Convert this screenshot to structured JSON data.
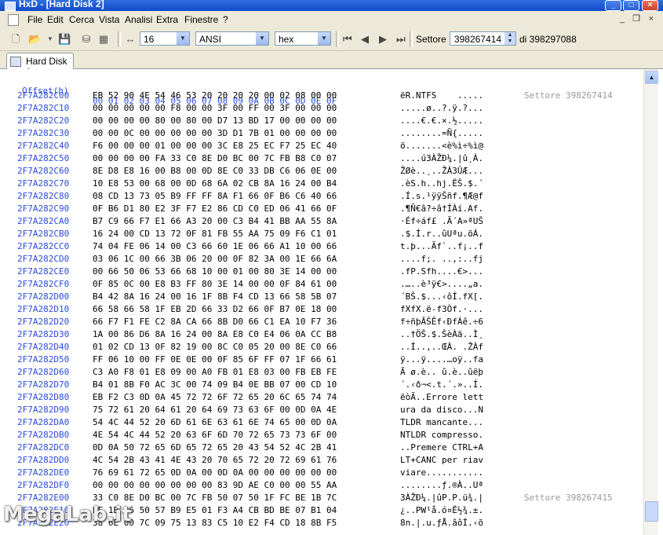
{
  "window": {
    "title": "HxD - [Hard Disk 2]",
    "minimize": "_",
    "maximize": "□",
    "close": "×"
  },
  "menu": {
    "items": [
      "File",
      "Edit",
      "Cerca",
      "Vista",
      "Analisi",
      "Extra",
      "Finestre",
      "?"
    ],
    "mdi_min": "_",
    "mdi_restore": "❐",
    "mdi_close": "×"
  },
  "toolbar": {
    "bytes_per_row": "16",
    "charset": "ANSI",
    "display": "hex",
    "sector_label": "Settore",
    "sector_value": "398267414",
    "sector_total": "di 398297088"
  },
  "tab": {
    "label": "Hard Disk 2"
  },
  "hex": {
    "offset_header": "Offset(h)",
    "column_header": "00 01 02 03 04 05 06 07 08 09 0A 0B 0C 0D 0E 0F",
    "rows": [
      {
        "o": "2F7A282C00",
        "b": "EB 52 90 4E 54 46 53 20 20 20 20 00 02 08 00 00",
        "a": "ëR.NTFS    .....",
        "s": "Settore 398267414"
      },
      {
        "o": "2F7A282C10",
        "b": "00 00 00 00 00 F8 00 00 3F 00 FF 00 3F 00 00 00",
        "a": ".....ø..?.ÿ.?...",
        "s": ""
      },
      {
        "o": "2F7A282C20",
        "b": "00 00 00 00 80 00 80 00 D7 13 BD 17 00 00 00 00",
        "a": "....€.€.×.½.....",
        "s": ""
      },
      {
        "o": "2F7A282C30",
        "b": "00 00 0C 00 00 00 00 00 3D D1 7B 01 00 00 00 00",
        "a": "........=Ñ{.....",
        "s": ""
      },
      {
        "o": "2F7A282C40",
        "b": "F6 00 00 00 01 00 00 00 3C E8 25 EC F7 25 EC 40",
        "a": "ö.......<è%ì÷%ì@",
        "s": ""
      },
      {
        "o": "2F7A282C50",
        "b": "00 00 00 00 FA 33 C0 8E D0 BC 00 7C FB B8 C0 07",
        "a": "....ú3ÀŽĐ¼.|û¸À.",
        "s": ""
      },
      {
        "o": "2F7A282C60",
        "b": "8E D8 E8 16 00 B8 00 0D 8E C0 33 DB C6 06 0E 00",
        "a": "ŽØè..¸..ŽÀ3ÛÆ...",
        "s": ""
      },
      {
        "o": "2F7A282C70",
        "b": "10 E8 53 00 68 00 0D 68 6A 02 CB 8A 16 24 00 B4",
        "a": ".èS.h..hj.ËŠ.$.´",
        "s": ""
      },
      {
        "o": "2F7A282C80",
        "b": "08 CD 13 73 05 B9 FF FF 8A F1 66 0F B6 C6 40 66",
        "a": ".Í.s.¹ÿÿŠñf.¶Æ@f",
        "s": ""
      },
      {
        "o": "2F7A282C90",
        "b": "0F B6 D1 80 E2 3F F7 E2 86 CD C0 ED 06 41 66 0F",
        "a": ".¶Ñ€â?÷â†ÍÀí.Af.",
        "s": ""
      },
      {
        "o": "2F7A282CA0",
        "b": "B7 C9 66 F7 E1 66 A3 20 00 C3 B4 41 BB AA 55 8A",
        "a": "·Éf÷áf£ .Ã´A»ªUŠ",
        "s": ""
      },
      {
        "o": "2F7A282CB0",
        "b": "16 24 00 CD 13 72 0F 81 FB 55 AA 75 09 F6 C1 01",
        "a": ".$.Í.r..ûUªu.öÁ.",
        "s": ""
      },
      {
        "o": "2F7A282CC0",
        "b": "74 04 FE 06 14 00 C3 66 60 1E 06 66 A1 10 00 66",
        "a": "t.þ...Ãf`..f¡..f",
        "s": ""
      },
      {
        "o": "2F7A282CD0",
        "b": "03 06 1C 00 66 3B 06 20 00 0F 82 3A 00 1E 66 6A",
        "a": "....f;. ..‚:..fj",
        "s": ""
      },
      {
        "o": "2F7A282CE0",
        "b": "00 66 50 06 53 66 68 10 00 01 00 80 3E 14 00 00",
        "a": ".fP.Sfh....€>...",
        "s": ""
      },
      {
        "o": "2F7A282CF0",
        "b": "0F 85 0C 00 E8 B3 FF 80 3E 14 00 00 0F 84 61 00",
        "a": ".…..è³ÿ€>....„a.",
        "s": ""
      },
      {
        "o": "2F7A282D00",
        "b": "B4 42 8A 16 24 00 16 1F 8B F4 CD 13 66 58 5B 07",
        "a": "´BŠ.$...‹ôÍ.fX[.",
        "s": ""
      },
      {
        "o": "2F7A282D10",
        "b": "66 58 66 58 1F EB 2D 66 33 D2 66 0F B7 0E 18 00",
        "a": "fXfX.ë-f3Òf.·...",
        "s": ""
      },
      {
        "o": "2F7A282D20",
        "b": "66 F7 F1 FE C2 8A CA 66 8B D0 66 C1 EA 10 F7 36",
        "a": "f÷ñþÂŠÊf‹ĐfÁê.÷6",
        "s": ""
      },
      {
        "o": "2F7A282D30",
        "b": "1A 00 86 D6 8A 16 24 00 8A E8 C0 E4 06 0A CC B8",
        "a": "..†ÖŠ.$.ŠèÀä..Ì¸",
        "s": ""
      },
      {
        "o": "2F7A282D40",
        "b": "01 02 CD 13 0F 82 19 00 8C C0 05 20 00 8E C0 66",
        "a": "..Í..‚..ŒÀ. .ŽÀf",
        "s": ""
      },
      {
        "o": "2F7A282D50",
        "b": "FF 06 10 00 FF 0E 0E 00 0F 85 6F FF 07 1F 66 61",
        "a": "ÿ...ÿ....…oÿ..fa",
        "s": ""
      },
      {
        "o": "2F7A282D60",
        "b": "C3 A0 F8 01 E8 09 00 A0 FB 01 E8 03 00 FB EB FE",
        "a": "Ã ø.è.. û.è..ûëþ",
        "s": ""
      },
      {
        "o": "2F7A282D70",
        "b": "B4 01 8B F0 AC 3C 00 74 09 B4 0E BB 07 00 CD 10",
        "a": "´.‹ð¬<.t.´.»..Í.",
        "s": ""
      },
      {
        "o": "2F7A282D80",
        "b": "EB F2 C3 0D 0A 45 72 72 6F 72 65 20 6C 65 74 74",
        "a": "ëòÃ..Errore lett",
        "s": ""
      },
      {
        "o": "2F7A282D90",
        "b": "75 72 61 20 64 61 20 64 69 73 63 6F 00 0D 0A 4E",
        "a": "ura da disco...N",
        "s": ""
      },
      {
        "o": "2F7A282DA0",
        "b": "54 4C 44 52 20 6D 61 6E 63 61 6E 74 65 00 0D 0A",
        "a": "TLDR mancante...",
        "s": ""
      },
      {
        "o": "2F7A282DB0",
        "b": "4E 54 4C 44 52 20 63 6F 6D 70 72 65 73 73 6F 00",
        "a": "NTLDR compresso.",
        "s": ""
      },
      {
        "o": "2F7A282DC0",
        "b": "0D 0A 50 72 65 6D 65 72 65 20 43 54 52 4C 2B 41",
        "a": "..Premere CTRL+A",
        "s": ""
      },
      {
        "o": "2F7A282DD0",
        "b": "4C 54 2B 43 41 4E 43 20 70 65 72 20 72 69 61 76",
        "a": "LT+CANC per riav",
        "s": ""
      },
      {
        "o": "2F7A282DE0",
        "b": "76 69 61 72 65 0D 0A 00 0D 0A 00 00 00 00 00 00",
        "a": "viare...........",
        "s": ""
      },
      {
        "o": "2F7A282DF0",
        "b": "00 00 00 00 00 00 00 00 83 9D AE C0 00 00 55 AA",
        "a": "........ƒ.®À..Uª",
        "s": ""
      },
      {
        "o": "2F7A282E00",
        "b": "33 C0 8E D0 BC 00 7C FB 50 07 50 1F FC BE 1B 7C",
        "a": "3ÀŽĐ¼.|ûP.P.ü¾.|",
        "s": "Settore 398267415"
      },
      {
        "o": "2F7A282E10",
        "b": "BF 1B 06 50 57 B9 E5 01 F3 A4 CB BD BE 07 B1 04",
        "a": "¿..PW¹å.ó¤Ë½¾.±.",
        "s": ""
      },
      {
        "o": "2F7A282E20",
        "b": "38 6E 00 7C 09 75 13 83 C5 10 E2 F4 CD 18 8B F5",
        "a": "8n.|.u.ƒÅ.âôÍ.‹õ",
        "s": ""
      }
    ]
  },
  "watermark": "MegaLab.it"
}
